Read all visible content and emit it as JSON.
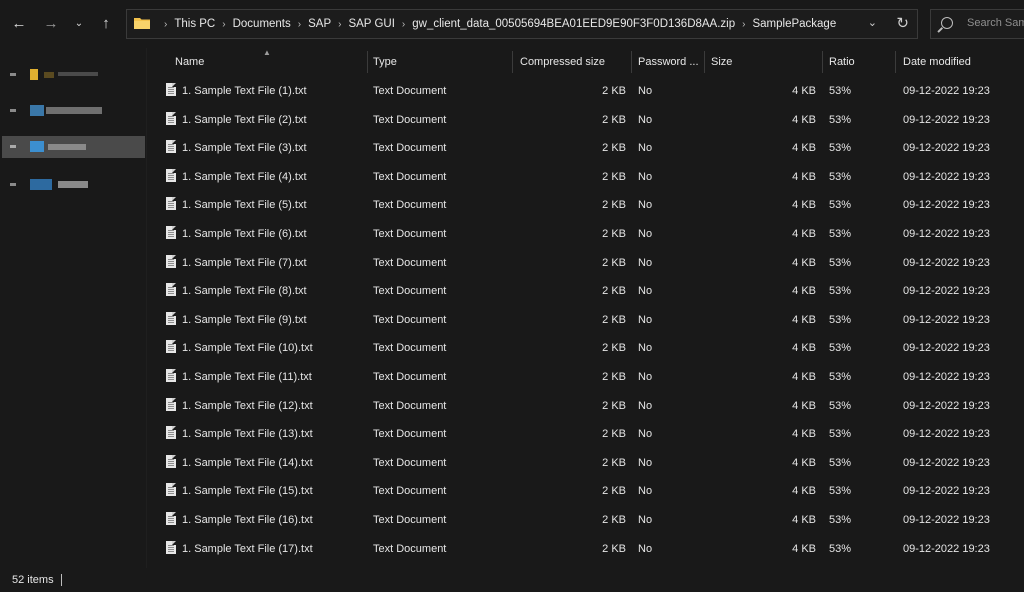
{
  "nav": {
    "back_icon": "back-arrow-icon",
    "forward_icon": "forward-arrow-icon",
    "recent_icon": "chevron-down-icon",
    "up_icon": "up-arrow-icon"
  },
  "address": {
    "segments": [
      "This PC",
      "Documents",
      "SAP",
      "SAP GUI",
      "gw_client_data_00505694BEA01EED9E90F3F0D136D8AA.zip",
      "SamplePackage"
    ]
  },
  "search": {
    "placeholder": "Search Sam"
  },
  "columns": {
    "name": "Name",
    "type": "Type",
    "compressed": "Compressed size",
    "password": "Password ...",
    "size": "Size",
    "ratio": "Ratio",
    "date": "Date modified"
  },
  "files": [
    {
      "name": "1. Sample Text File (1).txt",
      "type": "Text Document",
      "compressed": "2 KB",
      "password": "No",
      "size": "4 KB",
      "ratio": "53%",
      "date": "09-12-2022 19:23"
    },
    {
      "name": "1. Sample Text File (2).txt",
      "type": "Text Document",
      "compressed": "2 KB",
      "password": "No",
      "size": "4 KB",
      "ratio": "53%",
      "date": "09-12-2022 19:23"
    },
    {
      "name": "1. Sample Text File (3).txt",
      "type": "Text Document",
      "compressed": "2 KB",
      "password": "No",
      "size": "4 KB",
      "ratio": "53%",
      "date": "09-12-2022 19:23"
    },
    {
      "name": "1. Sample Text File (4).txt",
      "type": "Text Document",
      "compressed": "2 KB",
      "password": "No",
      "size": "4 KB",
      "ratio": "53%",
      "date": "09-12-2022 19:23"
    },
    {
      "name": "1. Sample Text File (5).txt",
      "type": "Text Document",
      "compressed": "2 KB",
      "password": "No",
      "size": "4 KB",
      "ratio": "53%",
      "date": "09-12-2022 19:23"
    },
    {
      "name": "1. Sample Text File (6).txt",
      "type": "Text Document",
      "compressed": "2 KB",
      "password": "No",
      "size": "4 KB",
      "ratio": "53%",
      "date": "09-12-2022 19:23"
    },
    {
      "name": "1. Sample Text File (7).txt",
      "type": "Text Document",
      "compressed": "2 KB",
      "password": "No",
      "size": "4 KB",
      "ratio": "53%",
      "date": "09-12-2022 19:23"
    },
    {
      "name": "1. Sample Text File (8).txt",
      "type": "Text Document",
      "compressed": "2 KB",
      "password": "No",
      "size": "4 KB",
      "ratio": "53%",
      "date": "09-12-2022 19:23"
    },
    {
      "name": "1. Sample Text File (9).txt",
      "type": "Text Document",
      "compressed": "2 KB",
      "password": "No",
      "size": "4 KB",
      "ratio": "53%",
      "date": "09-12-2022 19:23"
    },
    {
      "name": "1. Sample Text File (10).txt",
      "type": "Text Document",
      "compressed": "2 KB",
      "password": "No",
      "size": "4 KB",
      "ratio": "53%",
      "date": "09-12-2022 19:23"
    },
    {
      "name": "1. Sample Text File (11).txt",
      "type": "Text Document",
      "compressed": "2 KB",
      "password": "No",
      "size": "4 KB",
      "ratio": "53%",
      "date": "09-12-2022 19:23"
    },
    {
      "name": "1. Sample Text File (12).txt",
      "type": "Text Document",
      "compressed": "2 KB",
      "password": "No",
      "size": "4 KB",
      "ratio": "53%",
      "date": "09-12-2022 19:23"
    },
    {
      "name": "1. Sample Text File (13).txt",
      "type": "Text Document",
      "compressed": "2 KB",
      "password": "No",
      "size": "4 KB",
      "ratio": "53%",
      "date": "09-12-2022 19:23"
    },
    {
      "name": "1. Sample Text File (14).txt",
      "type": "Text Document",
      "compressed": "2 KB",
      "password": "No",
      "size": "4 KB",
      "ratio": "53%",
      "date": "09-12-2022 19:23"
    },
    {
      "name": "1. Sample Text File (15).txt",
      "type": "Text Document",
      "compressed": "2 KB",
      "password": "No",
      "size": "4 KB",
      "ratio": "53%",
      "date": "09-12-2022 19:23"
    },
    {
      "name": "1. Sample Text File (16).txt",
      "type": "Text Document",
      "compressed": "2 KB",
      "password": "No",
      "size": "4 KB",
      "ratio": "53%",
      "date": "09-12-2022 19:23"
    },
    {
      "name": "1. Sample Text File (17).txt",
      "type": "Text Document",
      "compressed": "2 KB",
      "password": "No",
      "size": "4 KB",
      "ratio": "53%",
      "date": "09-12-2022 19:23"
    }
  ],
  "status": {
    "item_count": "52 items"
  },
  "colors": {
    "background": "#191919",
    "selected_sidebar": "#4a4a4a",
    "folder_icon": "#f2c14b",
    "text": "#e6e6e6"
  }
}
